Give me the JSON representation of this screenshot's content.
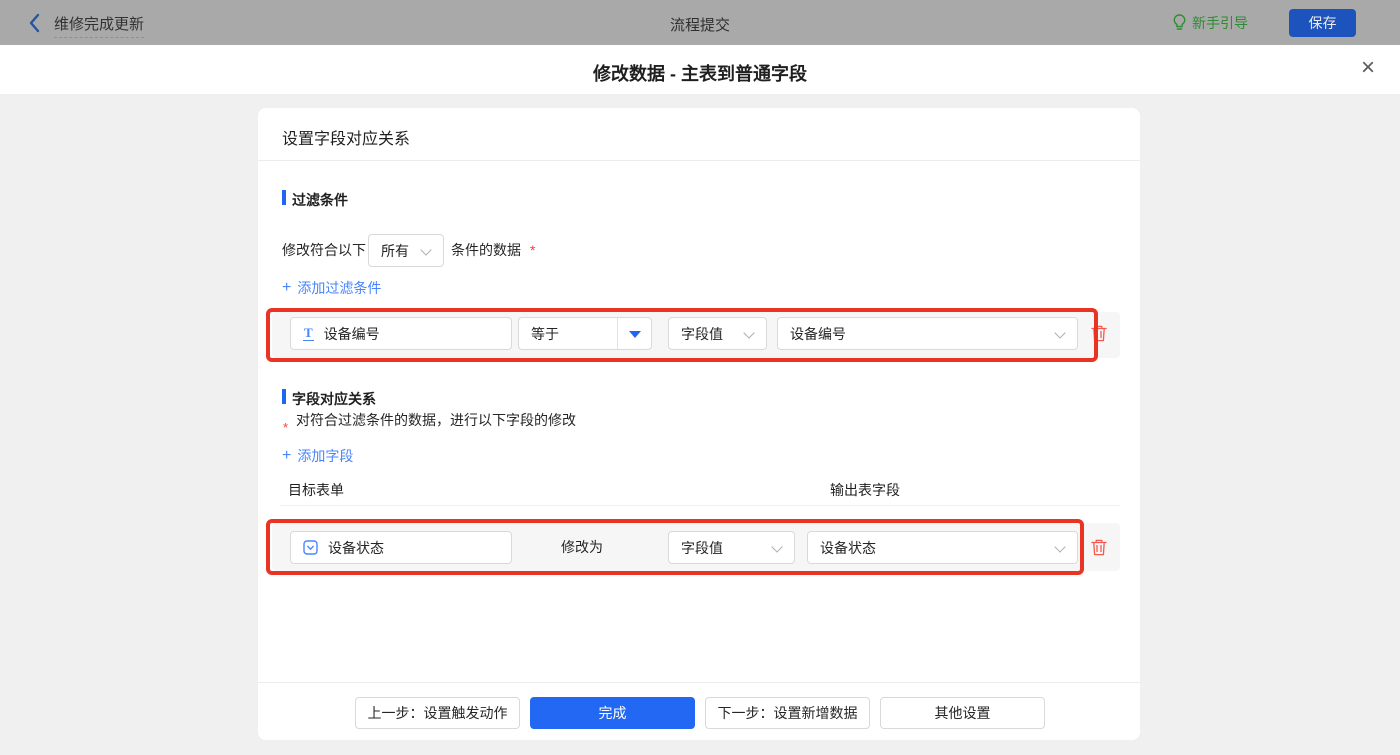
{
  "topbar": {
    "back_label": "维修完成更新",
    "title": "流程提交",
    "guide_label": "新手引导",
    "save_label": "保存"
  },
  "modal": {
    "title": "修改数据 - 主表到普通字段"
  },
  "panel": {
    "title": "设置字段对应关系"
  },
  "filter": {
    "section_title": "过滤条件",
    "sentence_prefix": "修改符合以下",
    "match_mode_value": "所有",
    "sentence_suffix": "条件的数据",
    "required_mark": "*",
    "add_label": "添加过滤条件",
    "row": {
      "field": "设备编号",
      "operator": "等于",
      "value_type": "字段值",
      "value_field": "设备编号"
    }
  },
  "mapping": {
    "section_title": "字段对应关系",
    "required_mark": "*",
    "description": "对符合过滤条件的数据，进行以下字段的修改",
    "add_label": "添加字段",
    "col_target": "目标表单",
    "col_output": "输出表字段",
    "row": {
      "field": "设备状态",
      "action_label": "修改为",
      "value_type": "字段值",
      "value_field": "设备状态"
    }
  },
  "footer": {
    "prev_label": "上一步：设置触发动作",
    "done_label": "完成",
    "next_label": "下一步：设置新增数据",
    "other_label": "其他设置"
  },
  "icons": {
    "plus": "+",
    "close": "×",
    "text_field": "T"
  },
  "colors": {
    "accent_blue": "#2368f2",
    "link_blue": "#4a85fd",
    "annotation_red": "#e93323",
    "danger_red": "#f5594e",
    "guide_green": "#2f8c33",
    "save_blue": "#1d53bd",
    "topbar_gray": "#a9a9a9"
  }
}
